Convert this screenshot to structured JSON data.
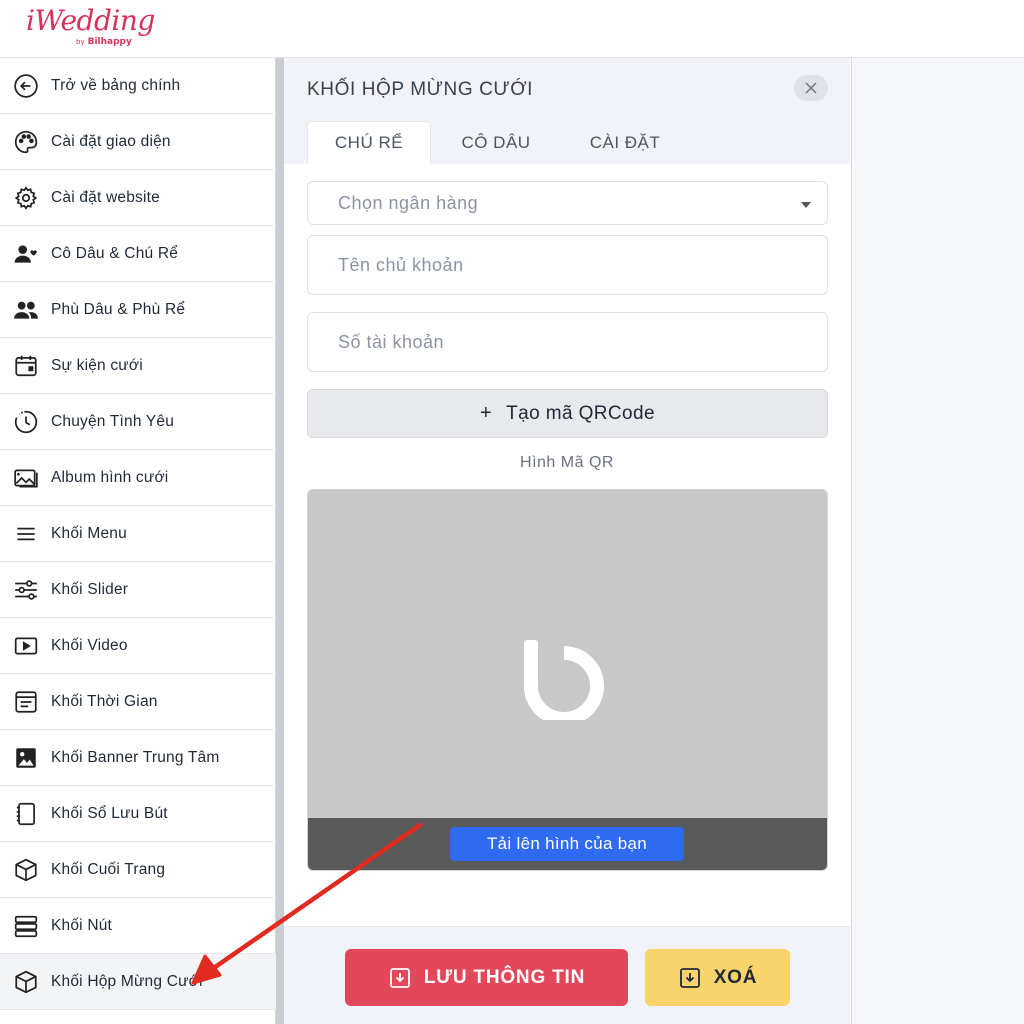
{
  "header": {
    "logo_text": "iWedding",
    "logo_by": "by",
    "logo_brand": "Bilhappy"
  },
  "sidebar": {
    "items": [
      {
        "label": "Trở về bảng chính",
        "icon": "arrow-left-circle-icon"
      },
      {
        "label": "Cài đặt giao diện",
        "icon": "palette-icon"
      },
      {
        "label": "Cài đặt website",
        "icon": "gear-icon"
      },
      {
        "label": "Cô Dâu & Chú Rể",
        "icon": "user-heart-icon"
      },
      {
        "label": "Phù Dâu & Phù Rể",
        "icon": "users-icon"
      },
      {
        "label": "Sự kiện cưới",
        "icon": "calendar-icon"
      },
      {
        "label": "Chuyện Tình Yêu",
        "icon": "clock-history-icon"
      },
      {
        "label": "Album hình cưới",
        "icon": "images-icon"
      },
      {
        "label": "Khối Menu",
        "icon": "menu-icon"
      },
      {
        "label": "Khối Slider",
        "icon": "sliders-icon"
      },
      {
        "label": "Khối Video",
        "icon": "video-play-icon"
      },
      {
        "label": "Khối Thời Gian",
        "icon": "calendar-block-icon"
      },
      {
        "label": "Khối Banner Trung Tâm",
        "icon": "image-icon"
      },
      {
        "label": "Khối Sổ Lưu Bút",
        "icon": "notebook-icon"
      },
      {
        "label": "Khối Cuối Trang",
        "icon": "box-icon"
      },
      {
        "label": "Khối Nút",
        "icon": "buttons-icon"
      },
      {
        "label": "Khối Hộp Mừng Cưới",
        "icon": "box-icon"
      }
    ],
    "active_index": 16
  },
  "panel": {
    "title": "KHỐI HỘP MỪNG CƯỚI",
    "tabs": [
      {
        "label": "CHÚ RỂ",
        "active": true
      },
      {
        "label": "CÔ DÂU",
        "active": false
      },
      {
        "label": "CÀI ĐẶT",
        "active": false
      }
    ],
    "bank_select_placeholder": "Chọn ngân hàng",
    "account_name_placeholder": "Tên chủ khoản",
    "account_number_placeholder": "Số tài khoản",
    "qr_button_label": "Tạo mã QRCode",
    "qr_button_prefix": "+",
    "qr_label": "Hình Mã QR",
    "upload_button_label": "Tải lên hình của bạn",
    "save_button_label": "LƯU THÔNG TIN",
    "delete_button_label": "XOÁ"
  },
  "colors": {
    "brand": "#d8325a",
    "save": "#e2485a",
    "delete": "#f8d46a",
    "upload": "#2f6bf0",
    "annotation_arrow": "#e02b20"
  }
}
